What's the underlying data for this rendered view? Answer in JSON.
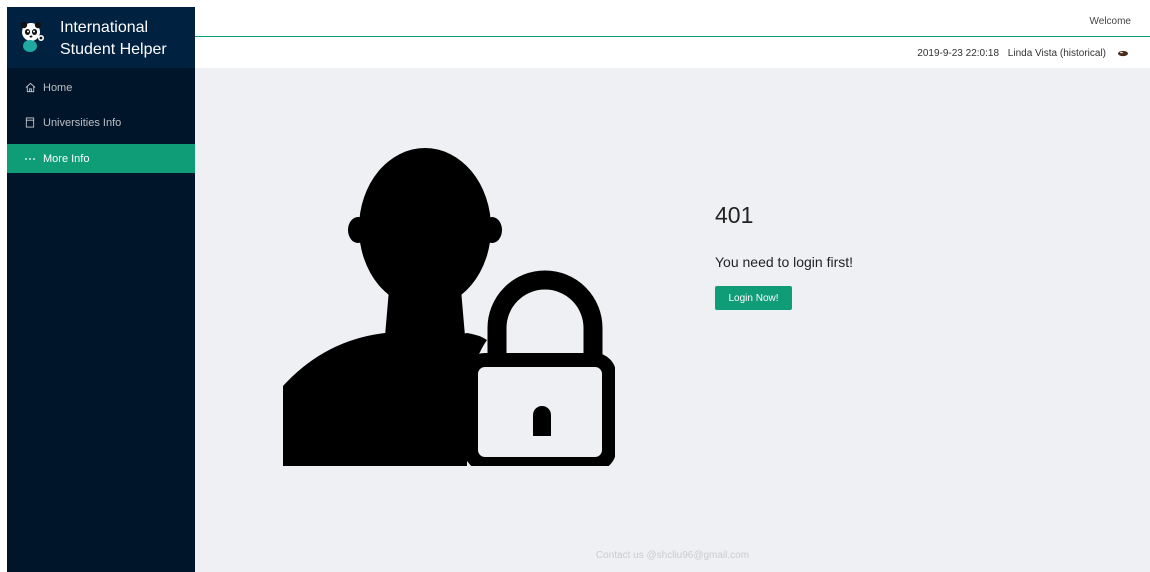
{
  "brand": {
    "title_line1": "International",
    "title_line2": "Student Helper",
    "logo_icon": "panda-logo-icon"
  },
  "sidebar": {
    "items": [
      {
        "label": "Home",
        "icon": "home-icon",
        "active": false
      },
      {
        "label": "Universities Info",
        "icon": "document-icon",
        "active": false
      },
      {
        "label": "More Info",
        "icon": "ellipsis-icon",
        "active": true
      }
    ]
  },
  "header": {
    "welcome": "Welcome",
    "datetime": "2019-9-23 22:0:18",
    "location": "Linda Vista (historical)",
    "weather_icon": "weather-icon"
  },
  "main": {
    "error_code": "401",
    "message": "You need to login first!",
    "login_button": "Login Now!",
    "illustration_icon": "user-lock-icon"
  },
  "footer": {
    "contact": "Contact us @shcliu96@gmail.com"
  },
  "colors": {
    "sidebar_bg": "#001529",
    "brand_bg": "#002140",
    "accent": "#0f9d78",
    "main_bg": "#eff0f3"
  }
}
